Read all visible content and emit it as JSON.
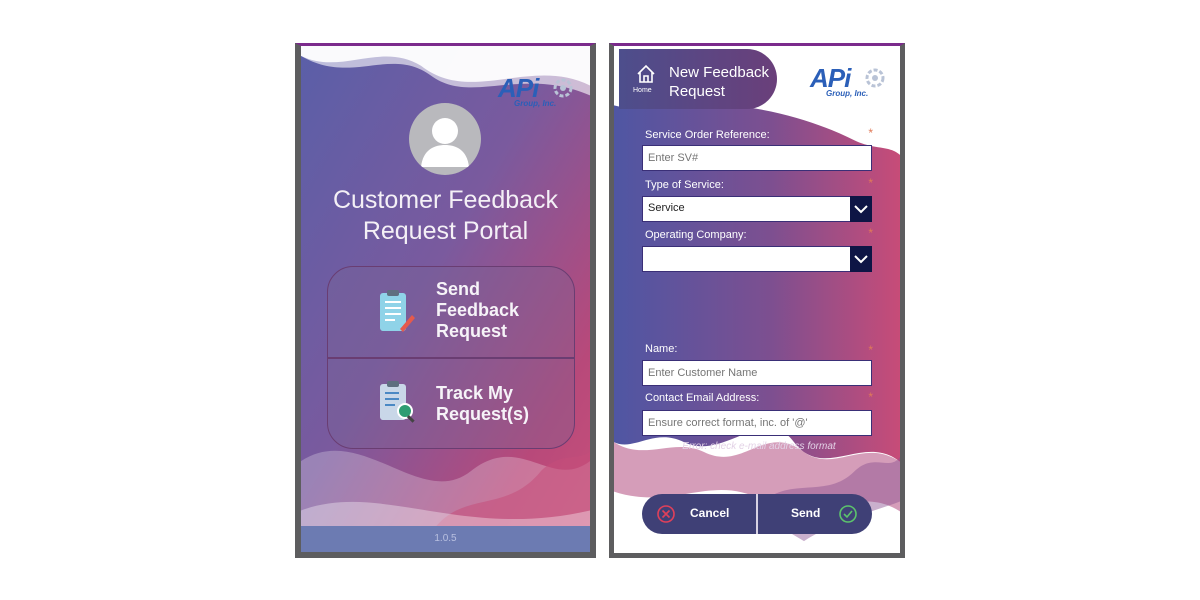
{
  "colors": {
    "gradient_blue": "#5a5fa8",
    "gradient_magenta": "#c9517b",
    "navy": "#0e1545",
    "required_orange": "#e07a58",
    "logo_blue": "#2b5fb8"
  },
  "logo": {
    "main": "APi",
    "sub": "Group, Inc.",
    "icon": "gear-icon"
  },
  "portal": {
    "title_line1": "Customer Feedback",
    "title_line2": "Request Portal",
    "avatar_icon": "user-avatar-icon",
    "menu": [
      {
        "lines": [
          "Send",
          "Feedback",
          "Request"
        ],
        "icon": "clipboard-pen-icon"
      },
      {
        "lines": [
          "Track My",
          "Request(s)"
        ],
        "icon": "clipboard-search-icon"
      }
    ],
    "version": "1.0.5"
  },
  "form": {
    "header": {
      "home_label": "Home",
      "title_line1": "New Feedback",
      "title_line2": "Request"
    },
    "required_mark": "*",
    "service_order": {
      "label": "Service Order Reference:",
      "placeholder": "Enter SV#"
    },
    "service_type": {
      "label": "Type of Service:",
      "value": "Service"
    },
    "operating_company": {
      "label": "Operating Company:",
      "value": ""
    },
    "name": {
      "label": "Name:",
      "placeholder": "Enter Customer Name"
    },
    "email": {
      "label": "Contact Email Address:",
      "placeholder": "Ensure correct format, inc. of '@'"
    },
    "error": "Error: check e-mail address format",
    "cancel_label": "Cancel",
    "send_label": "Send"
  }
}
